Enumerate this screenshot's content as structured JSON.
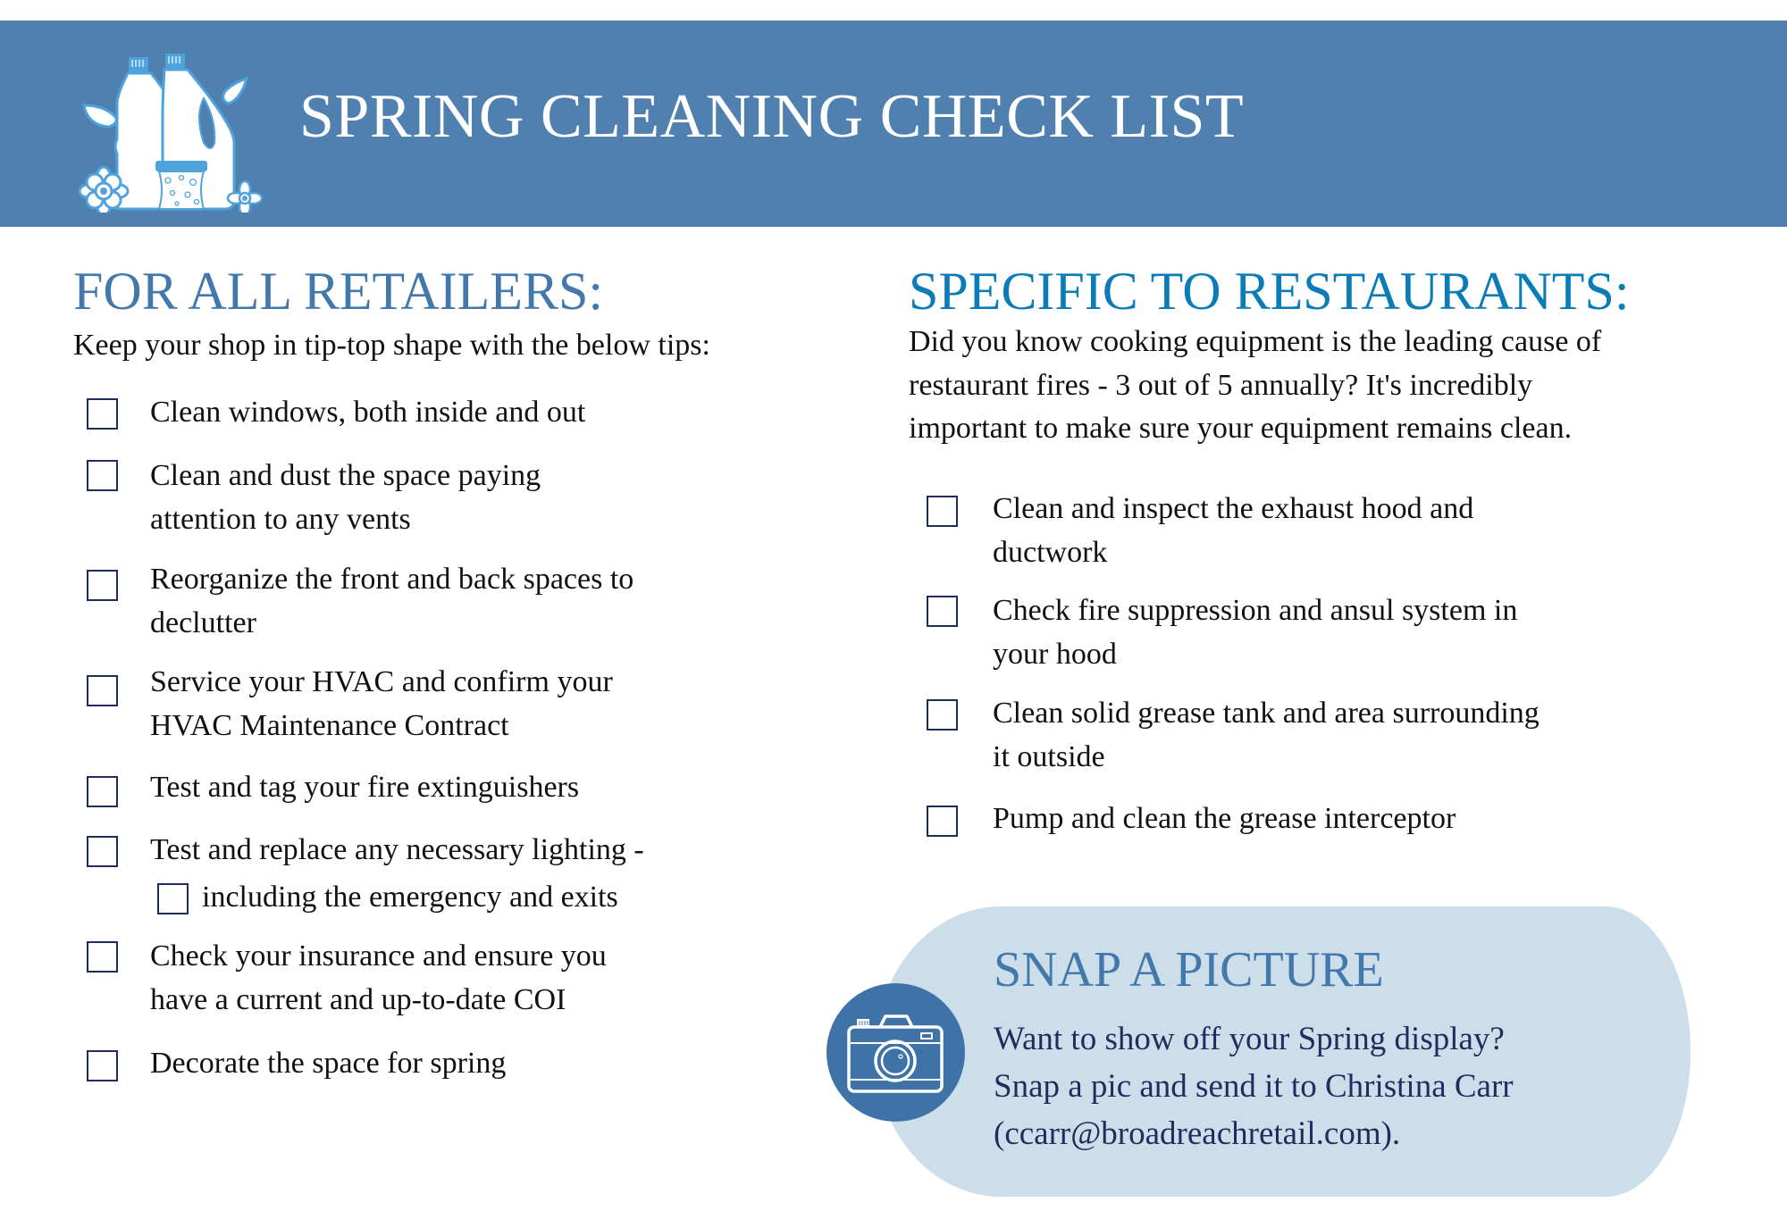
{
  "header": {
    "title": "SPRING CLEANING CHECK LIST",
    "logo_icon": "cleaning-supplies-icon",
    "band_color": "#4f80b0"
  },
  "left_section": {
    "heading": "FOR ALL RETAILERS:",
    "intro": "Keep your shop in tip-top shape with the below tips:",
    "items": [
      {
        "lines": [
          "Clean windows, both inside and out"
        ],
        "checked": false
      },
      {
        "lines": [
          "Clean and dust the space paying",
          "attention to any vents"
        ],
        "checked": false
      },
      {
        "lines": [
          "Reorganize the front and back spaces to",
          "declutter"
        ],
        "checked": false
      },
      {
        "lines": [
          "Service your HVAC and confirm your",
          "HVAC Maintenance Contract"
        ],
        "checked": false
      },
      {
        "lines": [
          "Test and tag your fire extinguishers"
        ],
        "checked": false
      },
      {
        "lines": [
          "Test and replace any necessary lighting -",
          "including the emergency and exits"
        ],
        "checked": false,
        "sub_checkbox_checked": false
      },
      {
        "lines": [
          "Check your insurance and ensure you",
          "have a current and up-to-date COI"
        ],
        "checked": false
      },
      {
        "lines": [
          "Decorate the space for spring"
        ],
        "checked": false
      }
    ]
  },
  "right_section": {
    "heading": "SPECIFIC TO RESTAURANTS:",
    "intro_lines": [
      "Did you know cooking equipment is the leading cause of",
      "restaurant fires - 3 out of 5 annually? It's incredibly",
      "important to make sure your equipment remains clean."
    ],
    "items": [
      {
        "lines": [
          "Clean and inspect the exhaust hood and",
          "ductwork"
        ],
        "checked": false
      },
      {
        "lines": [
          "Check fire suppression and ansul system in",
          "your hood"
        ],
        "checked": false
      },
      {
        "lines": [
          "Clean solid grease tank and area surrounding",
          "it outside"
        ],
        "checked": false
      },
      {
        "lines": [
          "Pump and clean the grease interceptor"
        ],
        "checked": false
      }
    ]
  },
  "snap_section": {
    "heading": "SNAP A PICTURE",
    "icon": "camera-icon",
    "body_lines": [
      "Want to show off your Spring display?",
      "Snap a pic and send it to Christina Carr",
      "(ccarr@broadreachretail.com)."
    ]
  },
  "colors": {
    "left_heading": "#4378ac",
    "right_heading": "#0b7cb8",
    "checkbox_border": "#1e2d5a",
    "snap_box_bg": "#cddeeb",
    "snap_circle": "#3f73a7",
    "snap_body_text": "#1f2d5c"
  }
}
